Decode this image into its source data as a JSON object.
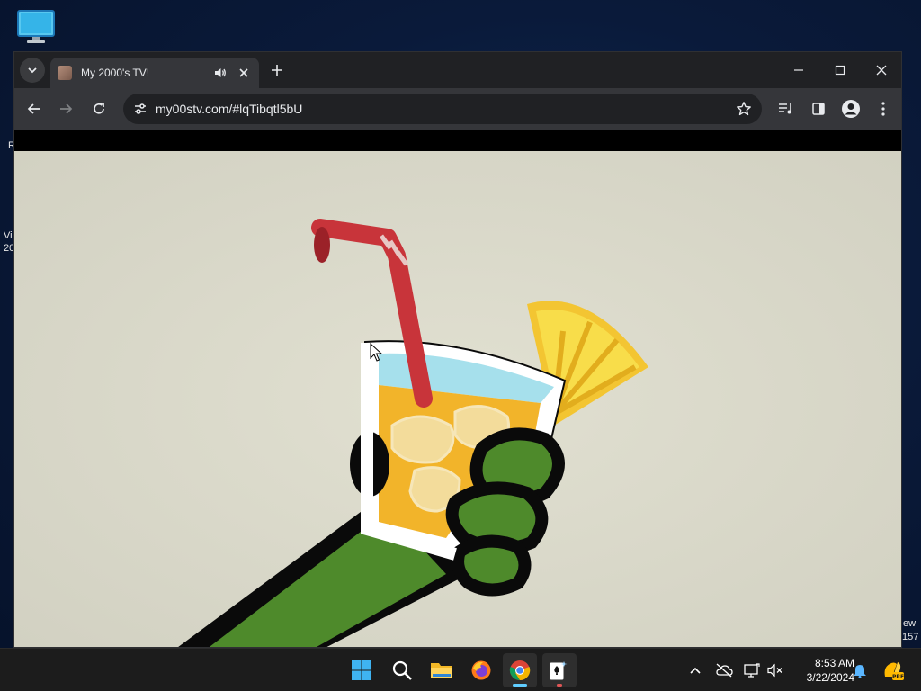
{
  "desktop": {
    "icon_name": "monitor-icon",
    "fragments": {
      "left_r": "R",
      "left_vi": "Vi",
      "left_20": "20",
      "right_ew": "ew",
      "right_157": "157"
    }
  },
  "browser": {
    "tab": {
      "title": "My 2000's TV!",
      "favicon": "site-favicon",
      "audio_icon": "speaker-icon",
      "close_icon": "close-icon"
    },
    "new_tab_icon": "plus-icon",
    "window_controls": [
      "minimize-icon",
      "maximize-icon",
      "close-icon"
    ],
    "toolbar": {
      "url": "my00stv.com/#lqTibqtl5bU",
      "icons": [
        "back-arrow-icon",
        "forward-arrow-icon",
        "reload-icon",
        "site-settings-icon",
        "bookmark-star-icon",
        "media-controls-icon",
        "side-panel-icon",
        "profile-icon",
        "menu-dots-icon"
      ]
    },
    "content": {
      "description_icons": [
        "cartoon-drink-image"
      ],
      "colors": {
        "background": "#d9d8c9",
        "arm_green": "#4e8a2b",
        "outline": "#0a0a0a",
        "straw_red": "#c8343a",
        "juice_orange": "#f2b42a",
        "water_blue": "#a6e0ec",
        "pineapple_yellow": "#f5d13a"
      }
    }
  },
  "taskbar": {
    "apps": [
      "windows-start-icon",
      "search-icon",
      "file-explorer-icon",
      "firefox-icon",
      "chrome-icon",
      "solitaire-icon"
    ],
    "tray": [
      "chevron-up-icon",
      "cloud-off-icon",
      "display-icon",
      "speaker-muted-icon",
      "notification-bell-icon",
      "copilot-icon"
    ],
    "time": "8:53 AM",
    "date": "3/22/2024"
  }
}
